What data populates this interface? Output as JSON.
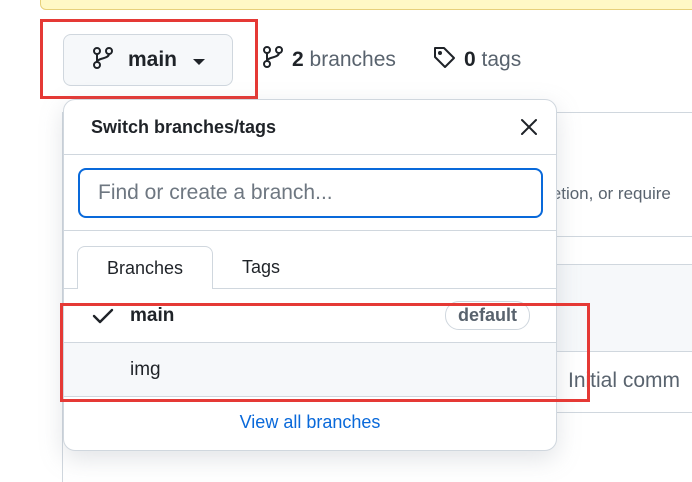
{
  "branch_selector": {
    "current_branch": "main",
    "branch_count": "2",
    "branch_count_label": "branches",
    "tag_count": "0",
    "tag_count_label": "tags"
  },
  "dropdown": {
    "title": "Switch branches/tags",
    "search_placeholder": "Find or create a branch...",
    "tabs": [
      {
        "label": "Branches",
        "active": true
      },
      {
        "label": "Tags",
        "active": false
      }
    ],
    "branches": [
      {
        "name": "main",
        "checked": true,
        "badge": "default"
      },
      {
        "name": "img",
        "checked": false,
        "badge": ""
      }
    ],
    "view_all_label": "View all branches"
  },
  "background": {
    "partial_text_1": "letion, or require",
    "partial_text_2": "Initial comm"
  },
  "colors": {
    "accent": "#0969da",
    "highlight": "#e53935"
  }
}
